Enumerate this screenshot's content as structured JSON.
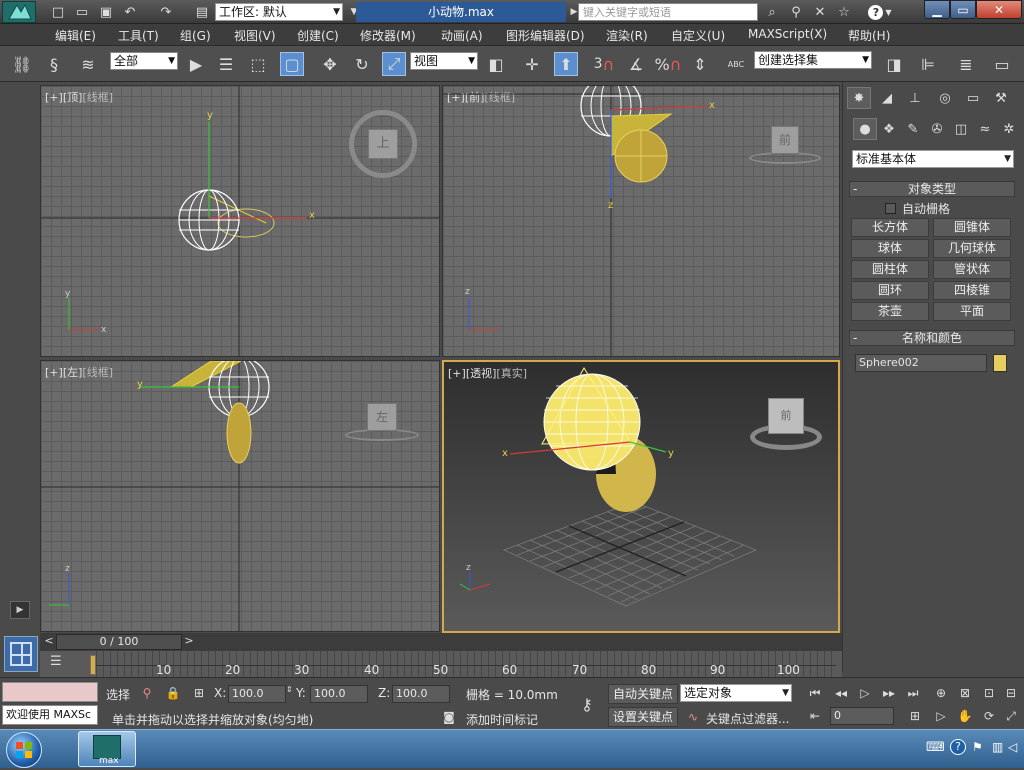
{
  "titlebar": {
    "workspace_label": "工作区: 默认",
    "document_title": "小动物.max",
    "search_placeholder": "键入关键字或短语",
    "help_label": "?"
  },
  "menu": [
    "编辑(E)",
    "工具(T)",
    "组(G)",
    "视图(V)",
    "创建(C)",
    "修改器(M)",
    "动画(A)",
    "图形编辑器(D)",
    "渲染(R)",
    "自定义(U)",
    "MAXScript(X)",
    "帮助(H)"
  ],
  "toolbar": {
    "filter_select": "全部",
    "coord_select": "视图",
    "snap_labels": [
      "3",
      "%"
    ],
    "named_selection": "创建选择集",
    "abc_label": "ABC"
  },
  "viewports": {
    "top": {
      "label_a": "[+]",
      "label_b": "[顶]",
      "label_c": "[线框]",
      "cube_label": "上"
    },
    "front": {
      "label_a": "[+]",
      "label_b": "[前]",
      "label_c": "[线框]",
      "cube_label": "前"
    },
    "left": {
      "label_a": "[+]",
      "label_b": "[左]",
      "label_c": "[线框]",
      "cube_label": "左"
    },
    "persp": {
      "label_a": "[+]",
      "label_b": "[透视]",
      "label_c": "[真实]",
      "cube_label": "前"
    },
    "axis": {
      "x": "x",
      "y": "y",
      "z": "z"
    }
  },
  "cmdpanel": {
    "category_select": "标准基本体",
    "object_type_title": "对象类型",
    "auto_grid": "自动栅格",
    "objects": [
      "长方体",
      "圆锥体",
      "球体",
      "几何球体",
      "圆柱体",
      "管状体",
      "圆环",
      "四棱锥",
      "茶壶",
      "平面"
    ],
    "name_color_title": "名称和颜色",
    "object_name": "Sphere002",
    "object_color": "#e6cf5e"
  },
  "timeline": {
    "frame_display": "0 / 100",
    "prev": "<",
    "next": ">",
    "ticks": [
      "10",
      "20",
      "30",
      "40",
      "50",
      "60",
      "70",
      "80",
      "90",
      "100"
    ]
  },
  "status": {
    "script_listener": "欢迎使用 MAXSc",
    "selection_label": "选择",
    "x_label": "X:",
    "x_value": "100.0",
    "y_label": "Y:",
    "y_value": "100.0",
    "z_label": "Z:",
    "z_value": "100.0",
    "grid_label": "栅格 = 10.0mm",
    "prompt": "单击并拖动以选择并缩放对象(均匀地)",
    "add_time_tag": "添加时间标记",
    "auto_key": "自动关键点",
    "set_key": "设置关键点",
    "key_mode_select": "选定对象",
    "key_filters": "关键点过滤器...",
    "current_frame": "0"
  },
  "taskbar": {
    "max_label": "max"
  }
}
